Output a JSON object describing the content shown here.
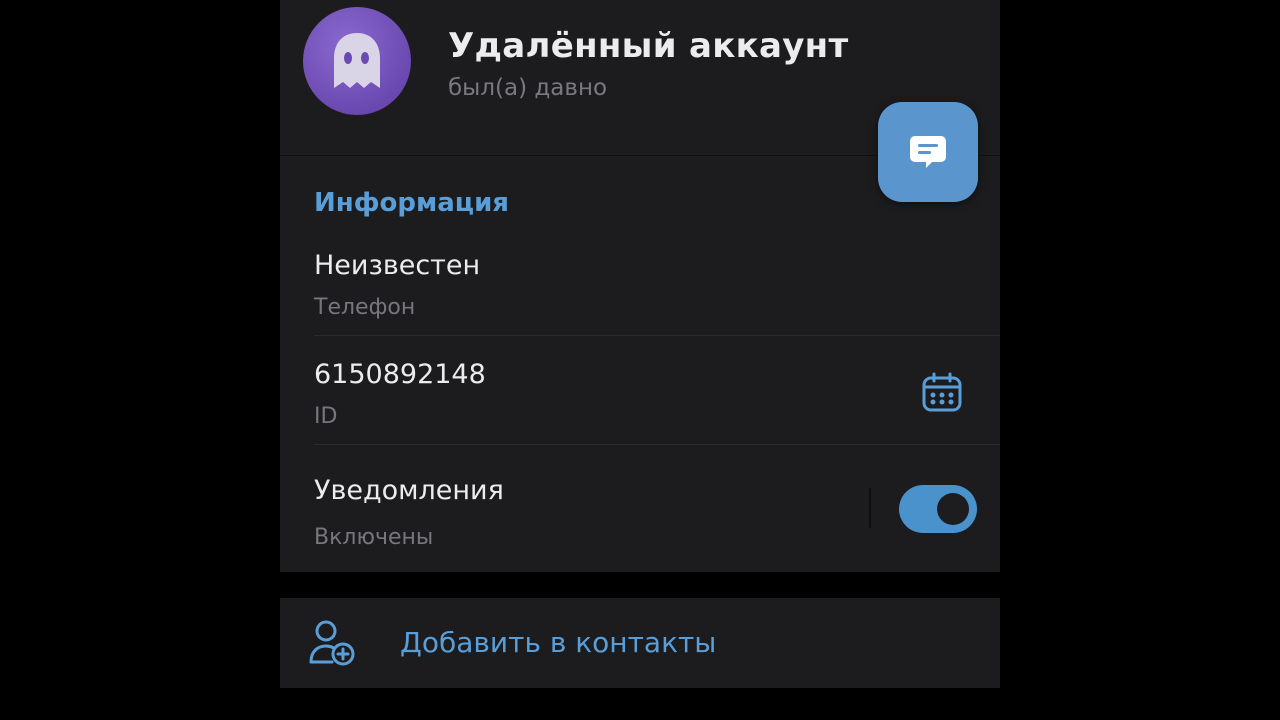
{
  "header": {
    "name": "Удалённый аккаунт",
    "status": "был(а) давно",
    "avatar_icon": "ghost-icon"
  },
  "fab": {
    "icon": "message-icon"
  },
  "info": {
    "title": "Информация",
    "phone": {
      "value": "Неизвестен",
      "label": "Телефон"
    },
    "id": {
      "value": "6150892148",
      "label": "ID",
      "icon": "calendar-icon"
    },
    "notifications": {
      "value": "Уведомления",
      "label": "Включены",
      "enabled": true
    }
  },
  "actions": {
    "add_contact": {
      "label": "Добавить в контакты",
      "icon": "add-user-icon"
    }
  },
  "colors": {
    "accent": "#5a9ed8",
    "toggle": "#4a92cc",
    "avatar": "#6a49b0",
    "card": "#1c1c1e"
  }
}
